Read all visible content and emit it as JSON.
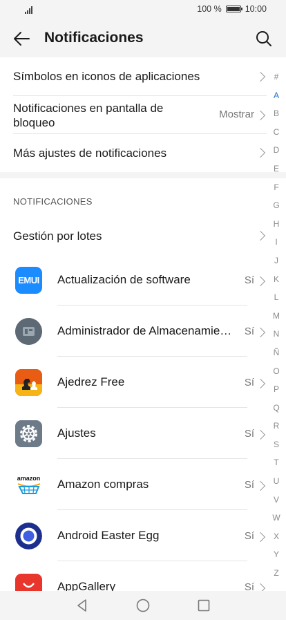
{
  "status_bar": {
    "battery_text": "100 %",
    "time": "10:00",
    "battery_level": 1.0
  },
  "header": {
    "title": "Notificaciones"
  },
  "top_settings": [
    {
      "label": "Símbolos en iconos de aplicaciones",
      "value": ""
    },
    {
      "label": "Notificaciones en pantalla de bloqueo",
      "value": "Mostrar"
    },
    {
      "label": "Más ajustes de notificaciones",
      "value": ""
    }
  ],
  "section": {
    "title": "NOTIFICACIONES",
    "batch_label": "Gestión por lotes"
  },
  "apps": [
    {
      "name": "Actualización de software",
      "status": "Sí",
      "icon": "emui-icon"
    },
    {
      "name": "Administrador de Almacenamiento",
      "status": "Sí",
      "icon": "storage-manager-icon"
    },
    {
      "name": "Ajedrez Free",
      "status": "Sí",
      "icon": "chess-icon"
    },
    {
      "name": "Ajustes",
      "status": "Sí",
      "icon": "settings-gear-icon"
    },
    {
      "name": "Amazon compras",
      "status": "Sí",
      "icon": "amazon-icon"
    },
    {
      "name": "Android Easter Egg",
      "status": "Sí",
      "icon": "easter-egg-icon"
    },
    {
      "name": "AppGallery",
      "status": "Sí",
      "icon": "appgallery-icon"
    }
  ],
  "alpha_index": [
    "#",
    "A",
    "B",
    "C",
    "D",
    "E",
    "F",
    "G",
    "H",
    "I",
    "J",
    "K",
    "L",
    "M",
    "N",
    "Ñ",
    "O",
    "P",
    "Q",
    "R",
    "S",
    "T",
    "U",
    "V",
    "W",
    "X",
    "Y",
    "Z"
  ],
  "alpha_active": "A",
  "icon_labels": {
    "emui": "EMUI",
    "amazon": "amazon"
  },
  "colors": {
    "accent": "#1f6fd6",
    "background": "#f4f4f4",
    "card": "#ffffff"
  }
}
